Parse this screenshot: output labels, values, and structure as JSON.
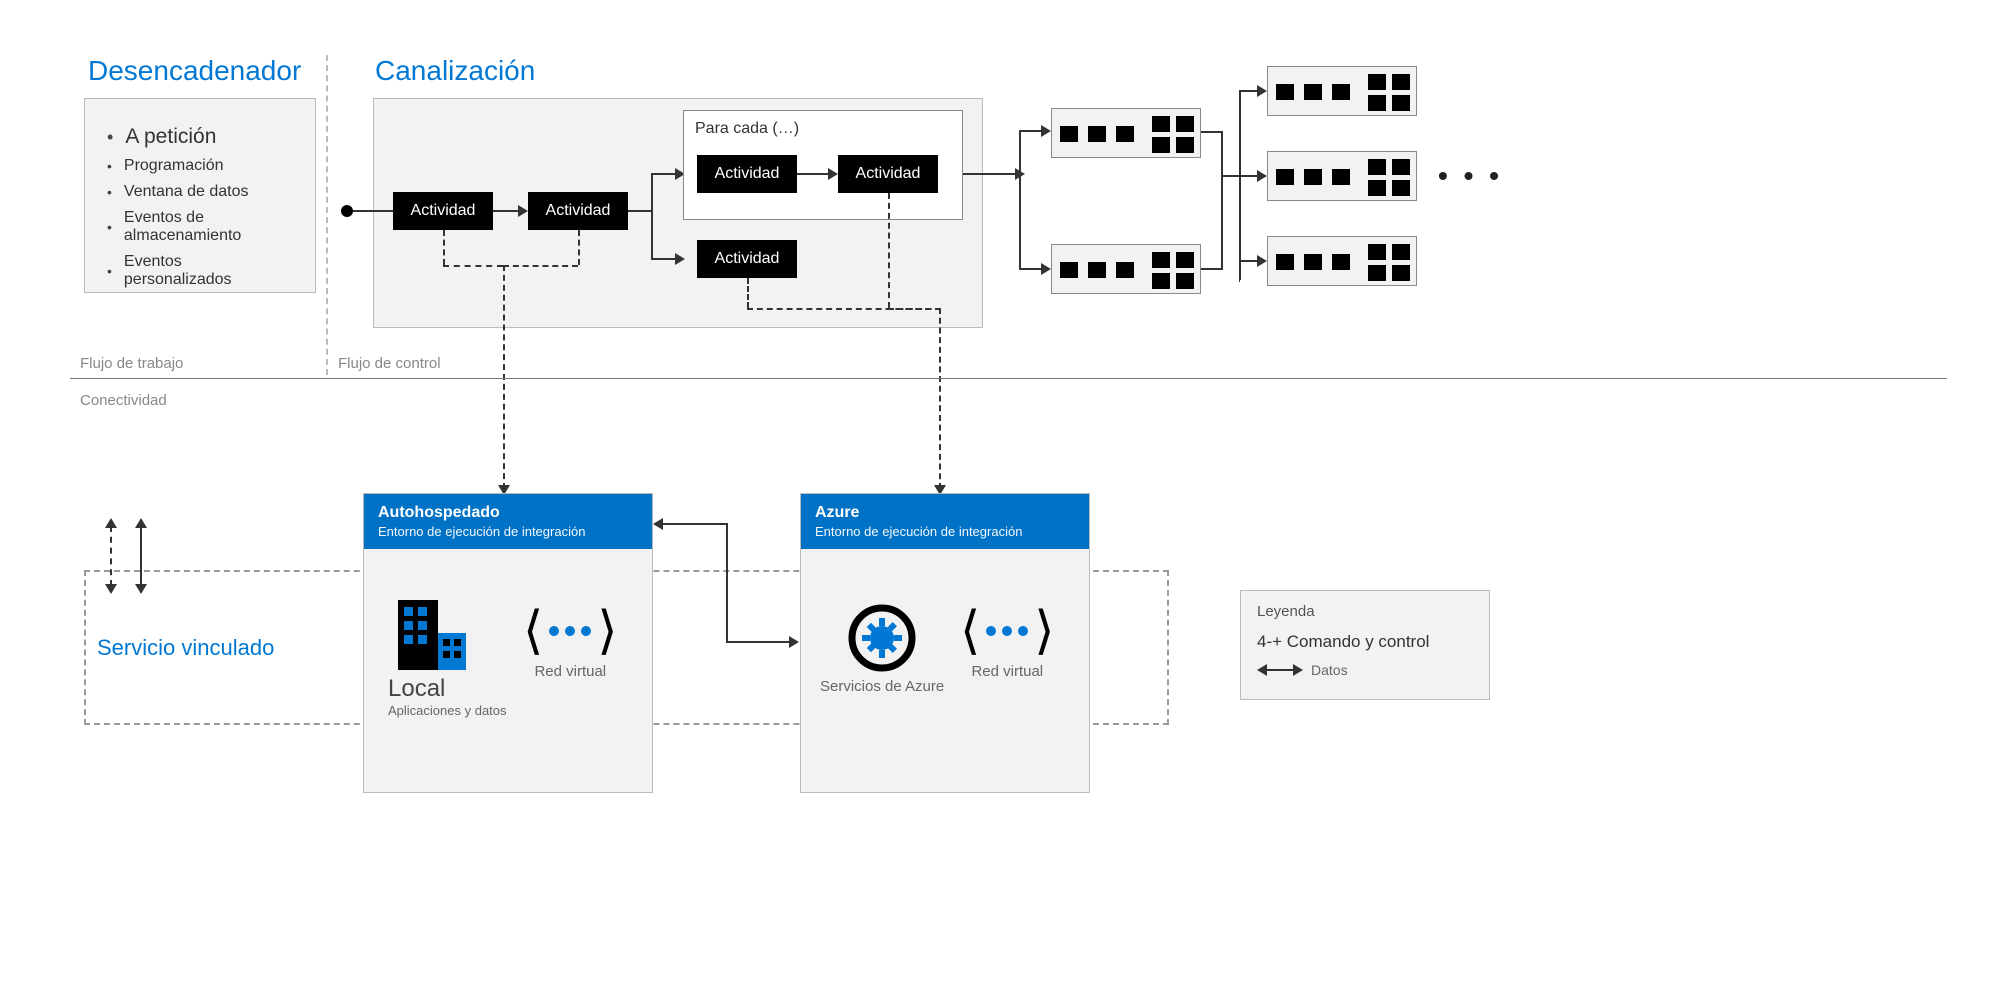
{
  "trigger": {
    "title": "Desencadenador",
    "items": [
      "A petición",
      "Programación",
      "Ventana de datos",
      "Eventos de almacenamiento",
      "Eventos personalizados"
    ]
  },
  "pipeline": {
    "title": "Canalización",
    "activity_label": "Actividad",
    "foreach_label": "Para cada (…)"
  },
  "labels": {
    "workflow": "Flujo de trabajo",
    "controlflow": "Flujo de control",
    "connectivity": "Conectividad",
    "linked_service": "Servicio vinculado"
  },
  "selfhosted": {
    "title": "Autohospedado",
    "sub": "Entorno de ejecución de integración",
    "local_title": "Local",
    "local_sub": "Aplicaciones y datos",
    "vnet": "Red virtual"
  },
  "azure": {
    "title": "Azure",
    "sub": "Entorno de ejecución de integración",
    "services": "Servicios de Azure",
    "vnet": "Red virtual"
  },
  "legend": {
    "title": "Leyenda",
    "cmd": "4-+ Comando y control",
    "data": "Datos"
  },
  "ellipsis": "• • •"
}
